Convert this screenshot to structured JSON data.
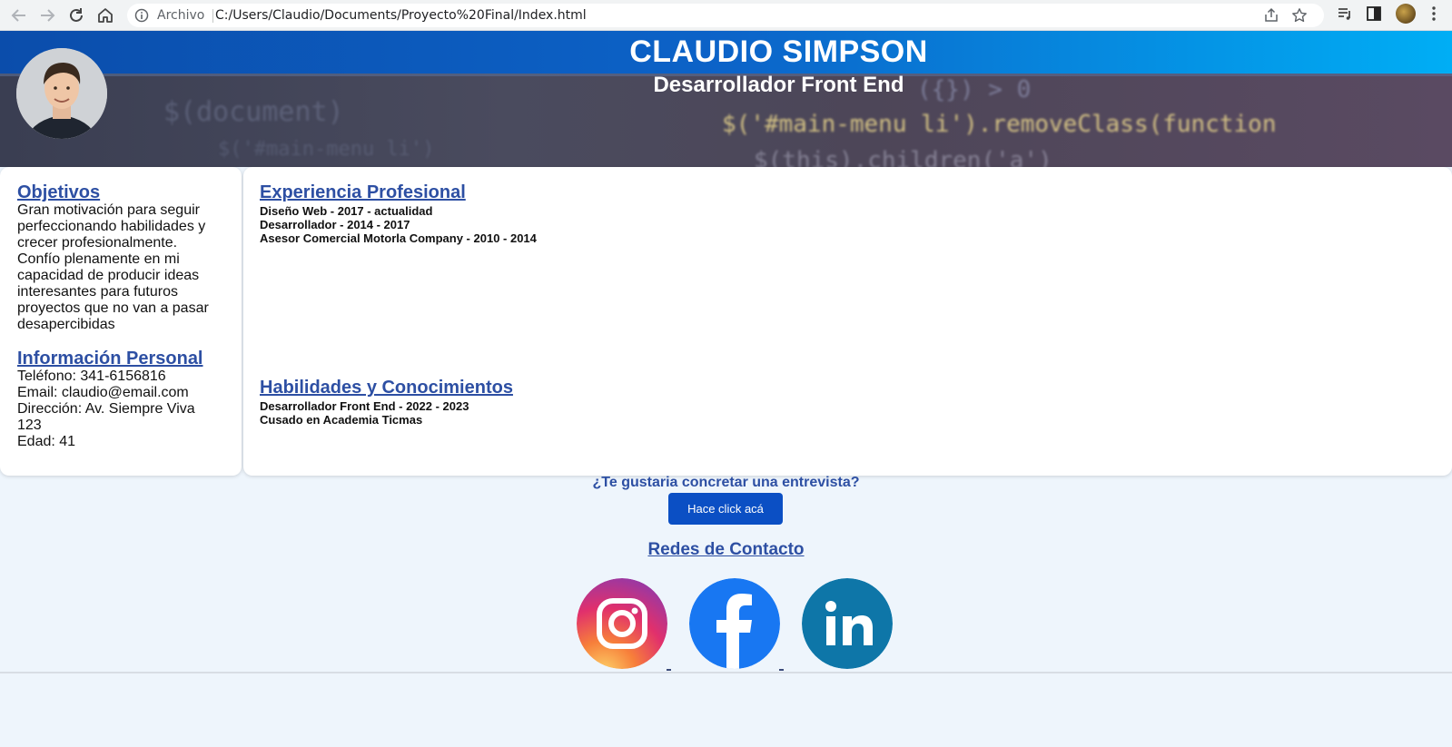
{
  "browser": {
    "scheme_label": "Archivo",
    "url": "C:/Users/Claudio/Documents/Proyecto%20Final/Index.html",
    "icons": [
      "back-arrow-icon",
      "forward-arrow-icon",
      "reload-icon",
      "home-icon",
      "info-icon",
      "share-icon",
      "bookmark-star-icon",
      "reading-list-icon",
      "side-panel-icon",
      "profile-avatar",
      "kebab-menu-icon"
    ]
  },
  "header": {
    "name": "CLAUDIO SIMPSON",
    "role": "Desarrollador Front End",
    "background_code": [
      "$('#main-menu li').removeClass(function",
      "$(this).children('a')",
      "({}) > 0",
      "$(document)",
      "$('#main-menu li')"
    ]
  },
  "sidebar": {
    "objectives_title": "Objetivos",
    "objectives_text": "Gran motivación para seguir perfeccionando habilidades y crecer profesionalmente. Confío plenamente en mi capacidad de producir ideas interesantes para futuros proyectos que no van a pasar desapercibidas",
    "personal_title": "Información Personal",
    "personal_lines": [
      "Teléfono: 341-6156816",
      "Email: claudio@email.com",
      "Dirección: Av. Siempre Viva 123",
      "Edad: 41"
    ]
  },
  "main": {
    "experience_title": "Experiencia Profesional",
    "experience_items": [
      "Diseño Web - 2017 - actualidad",
      "Desarrollador - 2014 - 2017",
      "Asesor Comercial Motorla Company - 2010 - 2014"
    ],
    "skills_title": "Habilidades y Conocimientos",
    "skills_items": [
      "Desarrollador Front End - 2022 - 2023",
      "Cusado en Academia Ticmas"
    ]
  },
  "footer": {
    "cta_question": "¿Te gustaria concretar una entrevista?",
    "cta_button": "Hace click acá",
    "socials_title": "Redes de Contacto",
    "socials": [
      "instagram-icon",
      "facebook-icon",
      "linkedin-icon"
    ]
  },
  "colors": {
    "accent_blue": "#2d4fa3",
    "button_blue": "#0b4fc4",
    "page_bg": "#eef5fc",
    "header_gradient_start": "#0b4dab",
    "header_gradient_end": "#00aef5"
  }
}
